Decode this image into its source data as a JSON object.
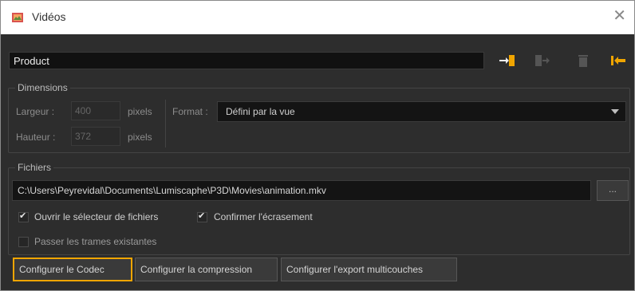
{
  "window": {
    "title": "Vidéos",
    "close_glyph": "✕"
  },
  "top": {
    "product_value": "Product",
    "icons": [
      "export-arrow-icon",
      "import-icon",
      "trash-icon",
      "collapse-arrow-icon"
    ]
  },
  "dimensions": {
    "group_title": "Dimensions",
    "width_label": "Largeur :",
    "width_value": "400",
    "height_label": "Hauteur :",
    "height_value": "372",
    "units_label": "pixels",
    "format_label": "Format :",
    "format_value": "Défini par la vue"
  },
  "files": {
    "group_title": "Fichiers",
    "path": "C:\\Users\\Peyrevidal\\Documents\\Lumiscaphe\\P3D\\Movies\\animation.mkv",
    "browse_label": "...",
    "open_file_picker_label": "Ouvrir le sélecteur de fichiers",
    "confirm_overwrite_label": "Confirmer l'écrasement",
    "skip_existing_frames_label": "Passer les trames existantes"
  },
  "buttons": {
    "configure_codec": "Configurer le Codec",
    "configure_compression": "Configurer la compression",
    "configure_multilayer_export": "Configurer l'export multicouches"
  },
  "colors": {
    "accent": "#f0a500",
    "background": "#2d2d2d"
  }
}
